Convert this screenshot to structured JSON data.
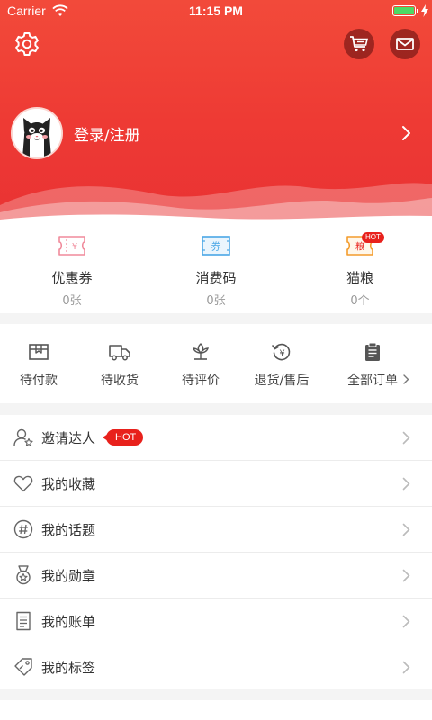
{
  "status_bar": {
    "carrier": "Carrier",
    "time": "11:15 PM",
    "battery_level": 1.0
  },
  "header": {
    "login_text": "登录/注册"
  },
  "assets": [
    {
      "name": "优惠券",
      "count": "0张",
      "icon": "coupon-icon"
    },
    {
      "name": "消费码",
      "count": "0张",
      "icon": "voucher-code-icon",
      "icon_text": "券"
    },
    {
      "name": "猫粮",
      "count": "0个",
      "icon": "cat-food-icon",
      "icon_text": "粮",
      "badge": "HOT"
    }
  ],
  "orders": [
    {
      "label": "待付款",
      "icon": "wallet-icon"
    },
    {
      "label": "待收货",
      "icon": "truck-icon"
    },
    {
      "label": "待评价",
      "icon": "rating-icon"
    },
    {
      "label": "退货/售后",
      "icon": "refund-icon"
    },
    {
      "label": "全部订单",
      "icon": "clipboard-icon"
    }
  ],
  "menu": [
    {
      "label": "邀请达人",
      "icon": "invite-user-icon",
      "badge": "HOT"
    },
    {
      "label": "我的收藏",
      "icon": "heart-icon"
    },
    {
      "label": "我的话题",
      "icon": "hashtag-icon"
    },
    {
      "label": "我的勋章",
      "icon": "medal-icon"
    },
    {
      "label": "我的账单",
      "icon": "bill-icon"
    },
    {
      "label": "我的标签",
      "icon": "tag-icon"
    }
  ],
  "colors": {
    "brand": "#ec3a34",
    "hot": "#e8211c",
    "coupon": "#f08a9b",
    "code": "#4aa7e6",
    "food": "#f39c2c"
  }
}
